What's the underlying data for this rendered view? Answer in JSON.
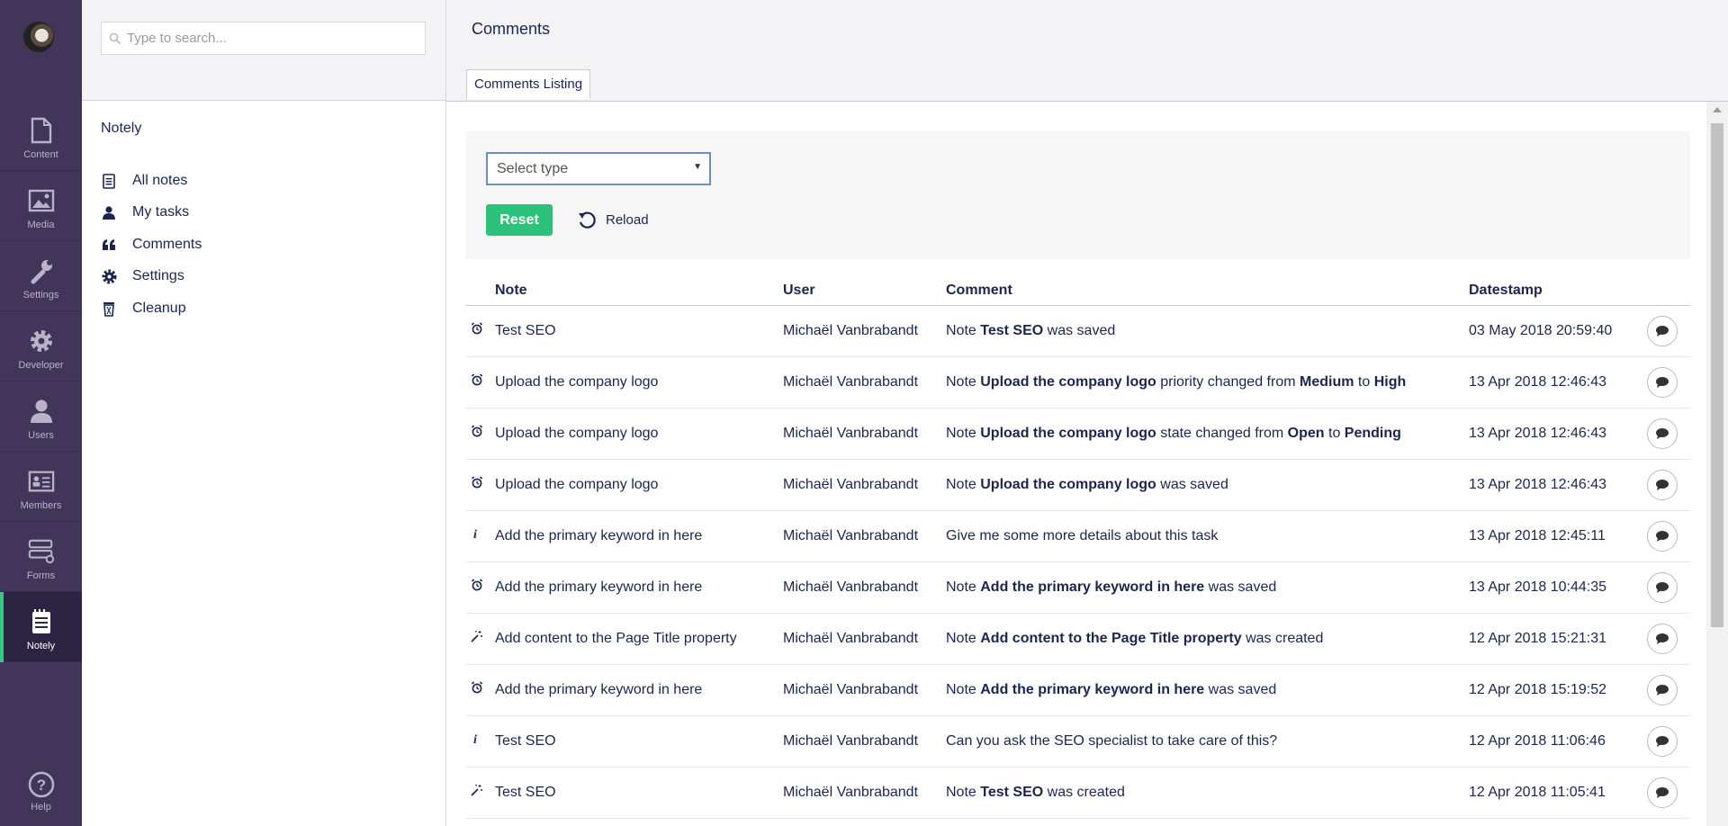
{
  "nav": {
    "sections": [
      {
        "name": "content",
        "label": "Content",
        "icon": "document-icon"
      },
      {
        "name": "media",
        "label": "Media",
        "icon": "image-icon"
      },
      {
        "name": "settings",
        "label": "Settings",
        "icon": "wrench-icon"
      },
      {
        "name": "developer",
        "label": "Developer",
        "icon": "gear-icon"
      },
      {
        "name": "users",
        "label": "Users",
        "icon": "user-icon"
      },
      {
        "name": "members",
        "label": "Members",
        "icon": "id-card-icon"
      },
      {
        "name": "forms",
        "label": "Forms",
        "icon": "forms-icon"
      },
      {
        "name": "notely",
        "label": "Notely",
        "icon": "notepad-icon"
      }
    ],
    "active": "notely",
    "help_label": "Help",
    "accent_color": "#35c786",
    "bg_color": "#413659"
  },
  "tree": {
    "search_placeholder": "Type to search...",
    "root_label": "Notely",
    "items": [
      {
        "label": "All notes",
        "icon": "notepad-icon"
      },
      {
        "label": "My tasks",
        "icon": "user-icon"
      },
      {
        "label": "Comments",
        "icon": "quote-icon"
      },
      {
        "label": "Settings",
        "icon": "gear-icon"
      },
      {
        "label": "Cleanup",
        "icon": "trash-icon"
      }
    ]
  },
  "header": {
    "title": "Comments",
    "tab": "Comments Listing"
  },
  "filter": {
    "select_placeholder": "Select type",
    "reset_label": "Reset",
    "reload_label": "Reload",
    "reset_color": "#2bc37c"
  },
  "table": {
    "columns": [
      "Note",
      "User",
      "Comment",
      "Datestamp"
    ],
    "rows": [
      {
        "type": "save",
        "note": "Test SEO",
        "user": "Michaël Vanbrabandt",
        "comment": [
          [
            "Note ",
            false
          ],
          [
            "Test SEO",
            true
          ],
          [
            " was saved",
            false
          ]
        ],
        "date": "03 May 2018 20:59:40"
      },
      {
        "type": "save",
        "note": "Upload the company logo",
        "user": "Michaël Vanbrabandt",
        "comment": [
          [
            "Note ",
            false
          ],
          [
            "Upload the company logo",
            true
          ],
          [
            " priority changed from ",
            false
          ],
          [
            "Medium",
            true
          ],
          [
            " to ",
            false
          ],
          [
            "High",
            true
          ]
        ],
        "date": "13 Apr 2018 12:46:43"
      },
      {
        "type": "save",
        "note": "Upload the company logo",
        "user": "Michaël Vanbrabandt",
        "comment": [
          [
            "Note ",
            false
          ],
          [
            "Upload the company logo",
            true
          ],
          [
            " state changed from ",
            false
          ],
          [
            "Open",
            true
          ],
          [
            " to ",
            false
          ],
          [
            "Pending",
            true
          ]
        ],
        "date": "13 Apr 2018 12:46:43"
      },
      {
        "type": "save",
        "note": "Upload the company logo",
        "user": "Michaël Vanbrabandt",
        "comment": [
          [
            "Note ",
            false
          ],
          [
            "Upload the company logo",
            true
          ],
          [
            " was saved",
            false
          ]
        ],
        "date": "13 Apr 2018 12:46:43"
      },
      {
        "type": "info",
        "note": "Add the primary keyword in here",
        "user": "Michaël Vanbrabandt",
        "comment": [
          [
            "Give me some more details about this task",
            false
          ]
        ],
        "date": "13 Apr 2018 12:45:11"
      },
      {
        "type": "save",
        "note": "Add the primary keyword in here",
        "user": "Michaël Vanbrabandt",
        "comment": [
          [
            "Note ",
            false
          ],
          [
            "Add the primary keyword in here",
            true
          ],
          [
            " was saved",
            false
          ]
        ],
        "date": "13 Apr 2018 10:44:35"
      },
      {
        "type": "create",
        "note": "Add content to the Page Title property",
        "user": "Michaël Vanbrabandt",
        "comment": [
          [
            "Note ",
            false
          ],
          [
            "Add content to the Page Title property",
            true
          ],
          [
            " was created",
            false
          ]
        ],
        "date": "12 Apr 2018 15:21:31"
      },
      {
        "type": "save",
        "note": "Add the primary keyword in here",
        "user": "Michaël Vanbrabandt",
        "comment": [
          [
            "Note ",
            false
          ],
          [
            "Add the primary keyword in here",
            true
          ],
          [
            " was saved",
            false
          ]
        ],
        "date": "12 Apr 2018 15:19:52"
      },
      {
        "type": "info",
        "note": "Test SEO",
        "user": "Michaël Vanbrabandt",
        "comment": [
          [
            "Can you ask the SEO specialist to take care of this?",
            false
          ]
        ],
        "date": "12 Apr 2018 11:06:46"
      },
      {
        "type": "create",
        "note": "Test SEO",
        "user": "Michaël Vanbrabandt",
        "comment": [
          [
            "Note ",
            false
          ],
          [
            "Test SEO",
            true
          ],
          [
            " was created",
            false
          ]
        ],
        "date": "12 Apr 2018 11:05:41"
      }
    ]
  }
}
